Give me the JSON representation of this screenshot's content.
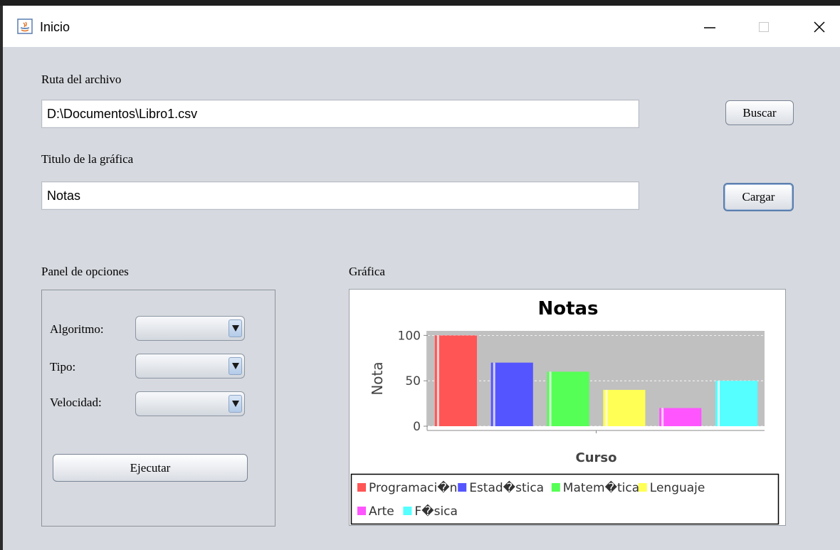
{
  "window": {
    "title": "Inicio",
    "minimize_icon": "minimize-icon",
    "maximize_icon": "maximize-icon",
    "close_icon": "close-icon"
  },
  "form": {
    "file_path_label": "Ruta del archivo",
    "file_path_value": "D:\\Documentos\\Libro1.csv",
    "browse_button": "Buscar",
    "chart_title_label": "Titulo de la gráfica",
    "chart_title_value": "Notas",
    "load_button": "Cargar"
  },
  "options_panel": {
    "title": "Panel de opciones",
    "algorithm_label": "Algoritmo:",
    "algorithm_value": "",
    "type_label": "Tipo:",
    "type_value": "",
    "speed_label": "Velocidad:",
    "speed_value": "",
    "run_button": "Ejecutar"
  },
  "chart_panel": {
    "title": "Gráfica"
  },
  "chart_data": {
    "type": "bar",
    "title": "Notas",
    "xlabel": "Curso",
    "ylabel": "Nota",
    "ylim": [
      0,
      105
    ],
    "yticks": [
      0,
      50,
      100
    ],
    "grid": true,
    "legend_position": "bottom",
    "categories": [
      "Programaci�n",
      "Estad�stica",
      "Matem�tica",
      "Lenguaje",
      "Arte",
      "F�sica"
    ],
    "values": [
      100,
      70,
      60,
      40,
      20,
      50
    ],
    "colors": [
      "#ff5555",
      "#5555ff",
      "#55ff55",
      "#ffff55",
      "#ff55ff",
      "#55ffff"
    ],
    "plot_background": "#c0c0c0"
  }
}
